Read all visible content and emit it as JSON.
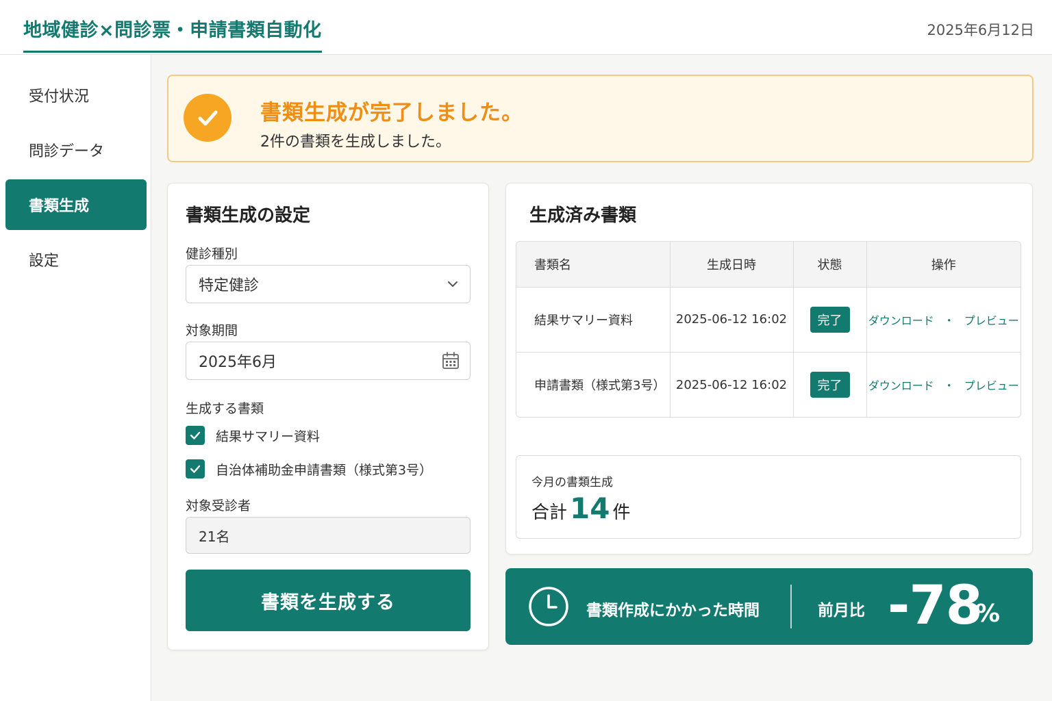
{
  "header": {
    "title": "地域健診×問診票・申請書類自動化",
    "date": "2025年6月12日"
  },
  "sidebar": {
    "items": [
      {
        "label": "受付状況",
        "active": false
      },
      {
        "label": "問診データ",
        "active": false
      },
      {
        "label": "書類生成",
        "active": true
      },
      {
        "label": "設定",
        "active": false
      }
    ]
  },
  "banner": {
    "title": "書類生成が完了しました。",
    "message": "2件の書類を生成しました。"
  },
  "settings": {
    "title": "書類生成の設定",
    "exam_type_label": "健診種別",
    "exam_type_value": "特定健診",
    "period_label": "対象期間",
    "period_value": "2025年6月",
    "documents_label": "生成する書類",
    "documents": [
      {
        "label": "結果サマリー資料",
        "checked": true
      },
      {
        "label": "自治体補助金申請書類（様式第3号）",
        "checked": true
      }
    ],
    "targets_label": "対象受診者",
    "targets_value": "21名",
    "generate_button": "書類を生成する"
  },
  "generated": {
    "title": "生成済み書類",
    "columns": [
      "書類名",
      "生成日時",
      "状態",
      "操作"
    ],
    "rows": [
      {
        "name": "結果サマリー資料",
        "datetime": "2025-06-12 16:02",
        "status": "完了",
        "download": "ダウンロード",
        "sep": "・",
        "preview": "プレビュー"
      },
      {
        "name": "申請書類（様式第3号）",
        "datetime": "2025-06-12 16:02",
        "status": "完了",
        "download": "ダウンロード",
        "sep": "・",
        "preview": "プレビュー"
      }
    ],
    "monthly_label": "今月の書類生成",
    "monthly_prefix": "合計",
    "monthly_count": "14",
    "monthly_unit": "件"
  },
  "time_saving": {
    "label": "書類作成にかかった時間",
    "compare_label": "前月比",
    "value": "-78",
    "unit": "%"
  },
  "colors": {
    "accent": "#137a70",
    "warning": "#f6a623",
    "warning_text": "#ef8e12",
    "banner_bg": "#fff7e8"
  }
}
